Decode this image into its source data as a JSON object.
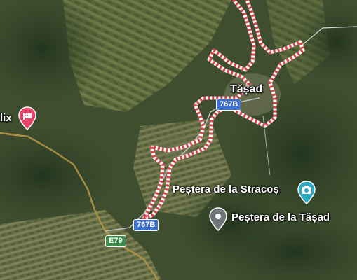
{
  "map": {
    "places": {
      "village": "Tășad",
      "cave_stracos": "Peștera de la Stracoș",
      "cave_tasad": "Peștera de la Tășad",
      "hotel_partial": "lix"
    },
    "roads": {
      "shield_767b_top": "767B",
      "shield_767b_bottom": "767B",
      "shield_e79": "E79"
    },
    "icons": {
      "hotel": "bed-icon",
      "cave_stracos": "camera-icon",
      "cave_tasad": "place-pin-icon"
    },
    "colors": {
      "boundary": "#d9434c",
      "hotel_pin": "#e8436a",
      "photo_pin": "#29a8c4",
      "poi_pin": "#70757a",
      "road_shield": "#3d6fd0",
      "euro_shield": "#3f8a4a",
      "main_road": "#c8a24a"
    }
  }
}
